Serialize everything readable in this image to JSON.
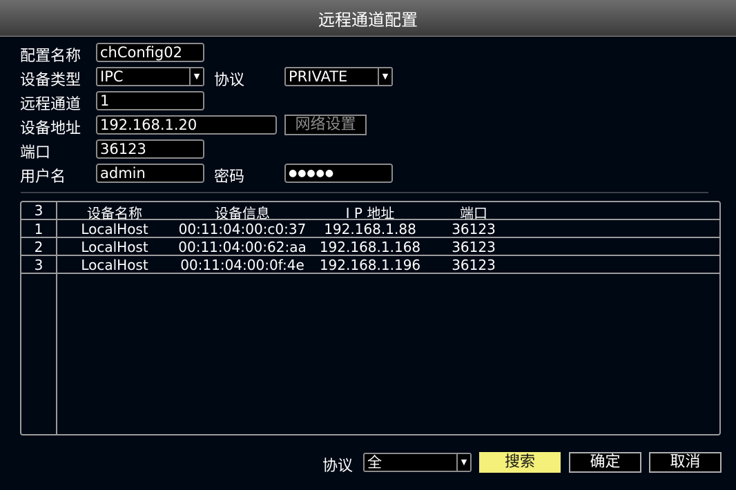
{
  "window": {
    "title": "远程通道配置"
  },
  "form": {
    "config_name_label": "配置名称",
    "config_name_value": "chConfig02",
    "device_type_label": "设备类型",
    "device_type_value": "IPC",
    "protocol_label": "协议",
    "protocol_value": "PRIVATE",
    "remote_channel_label": "远程通道",
    "remote_channel_value": "1",
    "device_address_label": "设备地址",
    "device_address_value": "192.168.1.20",
    "network_settings_label": "网络设置",
    "port_label": "端口",
    "port_value": "36123",
    "username_label": "用户名",
    "username_value": "admin",
    "password_label": "密码",
    "password_value": "●●●●●"
  },
  "table": {
    "headers": [
      "3",
      "设备名称",
      "设备信息",
      "I P 地址",
      "端口"
    ],
    "rows": [
      [
        "1",
        "LocalHost",
        "00:11:04:00:c0:37",
        "192.168.1.88",
        "36123"
      ],
      [
        "2",
        "LocalHost",
        "00:11:04:00:62:aa",
        "192.168.1.168",
        "36123"
      ],
      [
        "3",
        "LocalHost",
        "00:11:04:00:0f:4e",
        "192.168.1.196",
        "36123"
      ]
    ]
  },
  "footer": {
    "protocol_label": "协议",
    "protocol_value": "全",
    "search_label": "搜索",
    "ok_label": "确定",
    "cancel_label": "取消"
  },
  "icons": {
    "dropdown": "chevron-down-icon"
  }
}
